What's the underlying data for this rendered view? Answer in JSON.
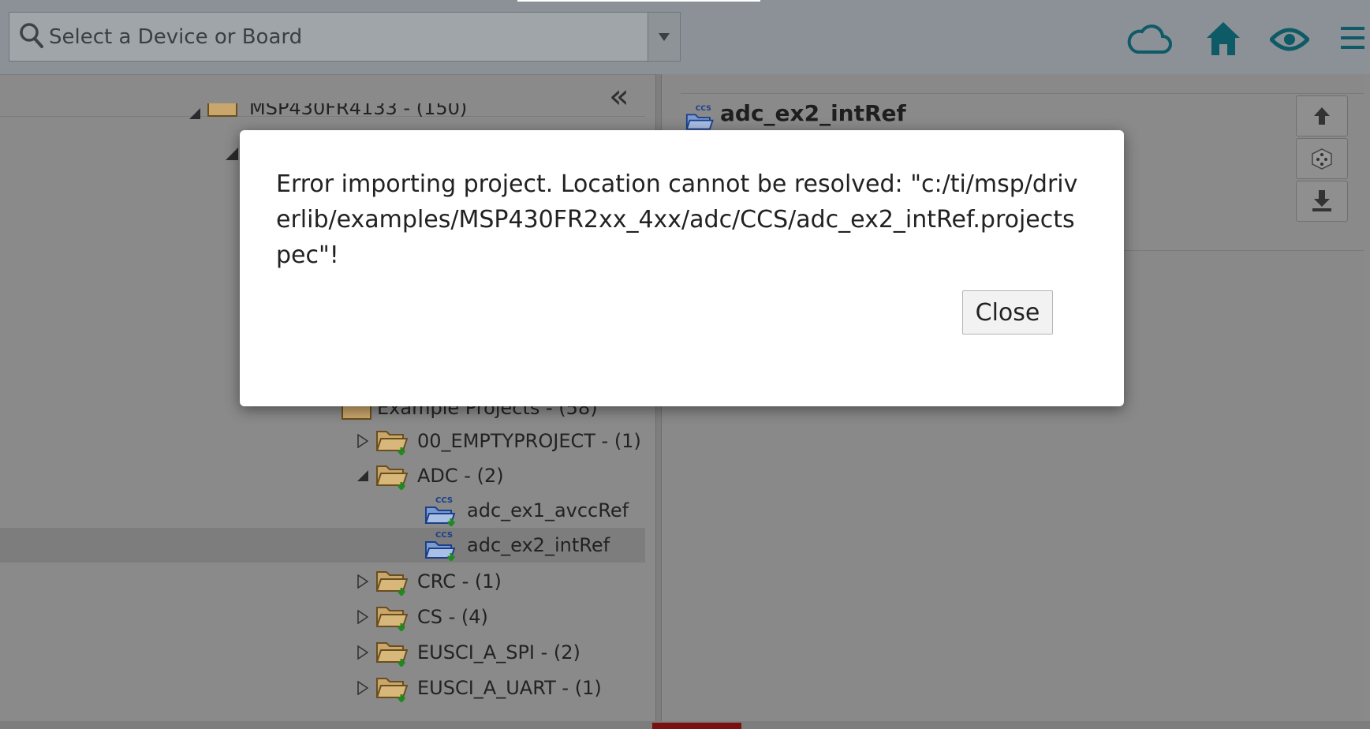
{
  "toolbar": {
    "search_placeholder": "Select a Device or Board",
    "icons": [
      "cloud-icon",
      "home-icon",
      "eye-icon",
      "menu-icon"
    ],
    "accent_color": "#0e5a66"
  },
  "tree": {
    "partial_top_label": "MSP430FR4133 - (150)",
    "partial_mid_label": "Example Projects - (58)",
    "items": [
      {
        "label": "00_EMPTYPROJECT - (1)",
        "kind": "folder",
        "expanded": false
      },
      {
        "label": "ADC - (2)",
        "kind": "folder",
        "expanded": true
      },
      {
        "label": "adc_ex1_avccRef",
        "kind": "project"
      },
      {
        "label": "adc_ex2_intRef",
        "kind": "project",
        "selected": true
      },
      {
        "label": "CRC - (1)",
        "kind": "folder",
        "expanded": false
      },
      {
        "label": "CS - (4)",
        "kind": "folder",
        "expanded": false
      },
      {
        "label": "EUSCI_A_SPI - (2)",
        "kind": "folder",
        "expanded": false
      },
      {
        "label": "EUSCI_A_UART - (1)",
        "kind": "folder",
        "expanded": false
      }
    ]
  },
  "detail": {
    "title": "adc_ex2_intRef"
  },
  "modal": {
    "message": "Error importing project. Location cannot be resolved: \"c:/ti/msp/driverlib/examples/MSP430FR2xx_4xx/adc/CCS/adc_ex2_intRef.projectspec\"!",
    "close_label": "Close"
  }
}
